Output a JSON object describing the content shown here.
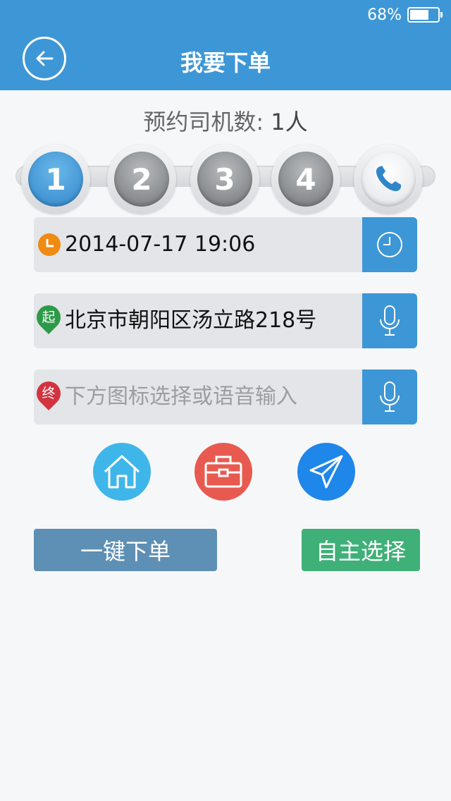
{
  "status": {
    "battery": "68%"
  },
  "header": {
    "title": "我要下单"
  },
  "driver_count": {
    "label": "预约司机数:",
    "value": "1人"
  },
  "steps": [
    {
      "label": "1",
      "state": "active"
    },
    {
      "label": "2",
      "state": "inactive"
    },
    {
      "label": "3",
      "state": "inactive"
    },
    {
      "label": "4",
      "state": "inactive"
    },
    {
      "icon": "phone-icon"
    }
  ],
  "time_field": {
    "value": "2014-07-17 19:06",
    "icon": "clock-icon",
    "button_icon": "clock-icon"
  },
  "start_field": {
    "badge": "起",
    "value": "北京市朝阳区汤立路218号",
    "button_icon": "microphone-icon"
  },
  "end_field": {
    "badge": "终",
    "placeholder": "下方图标选择或语音输入",
    "button_icon": "microphone-icon"
  },
  "quick_picks": [
    {
      "icon": "home-icon",
      "color": "#3fb6ea"
    },
    {
      "icon": "briefcase-icon",
      "color": "#e85a4f"
    },
    {
      "icon": "paper-plane-icon",
      "color": "#1f86ea"
    }
  ],
  "actions": {
    "one_click": {
      "label": "一键下单",
      "color": "#5e8fb4"
    },
    "self_select": {
      "label": "自主选择",
      "color": "#3fb078"
    }
  },
  "colors": {
    "primary": "#3d97d6",
    "accent_orange": "#ef8a12",
    "start_green": "#2d9a48",
    "end_red": "#d2333f"
  }
}
